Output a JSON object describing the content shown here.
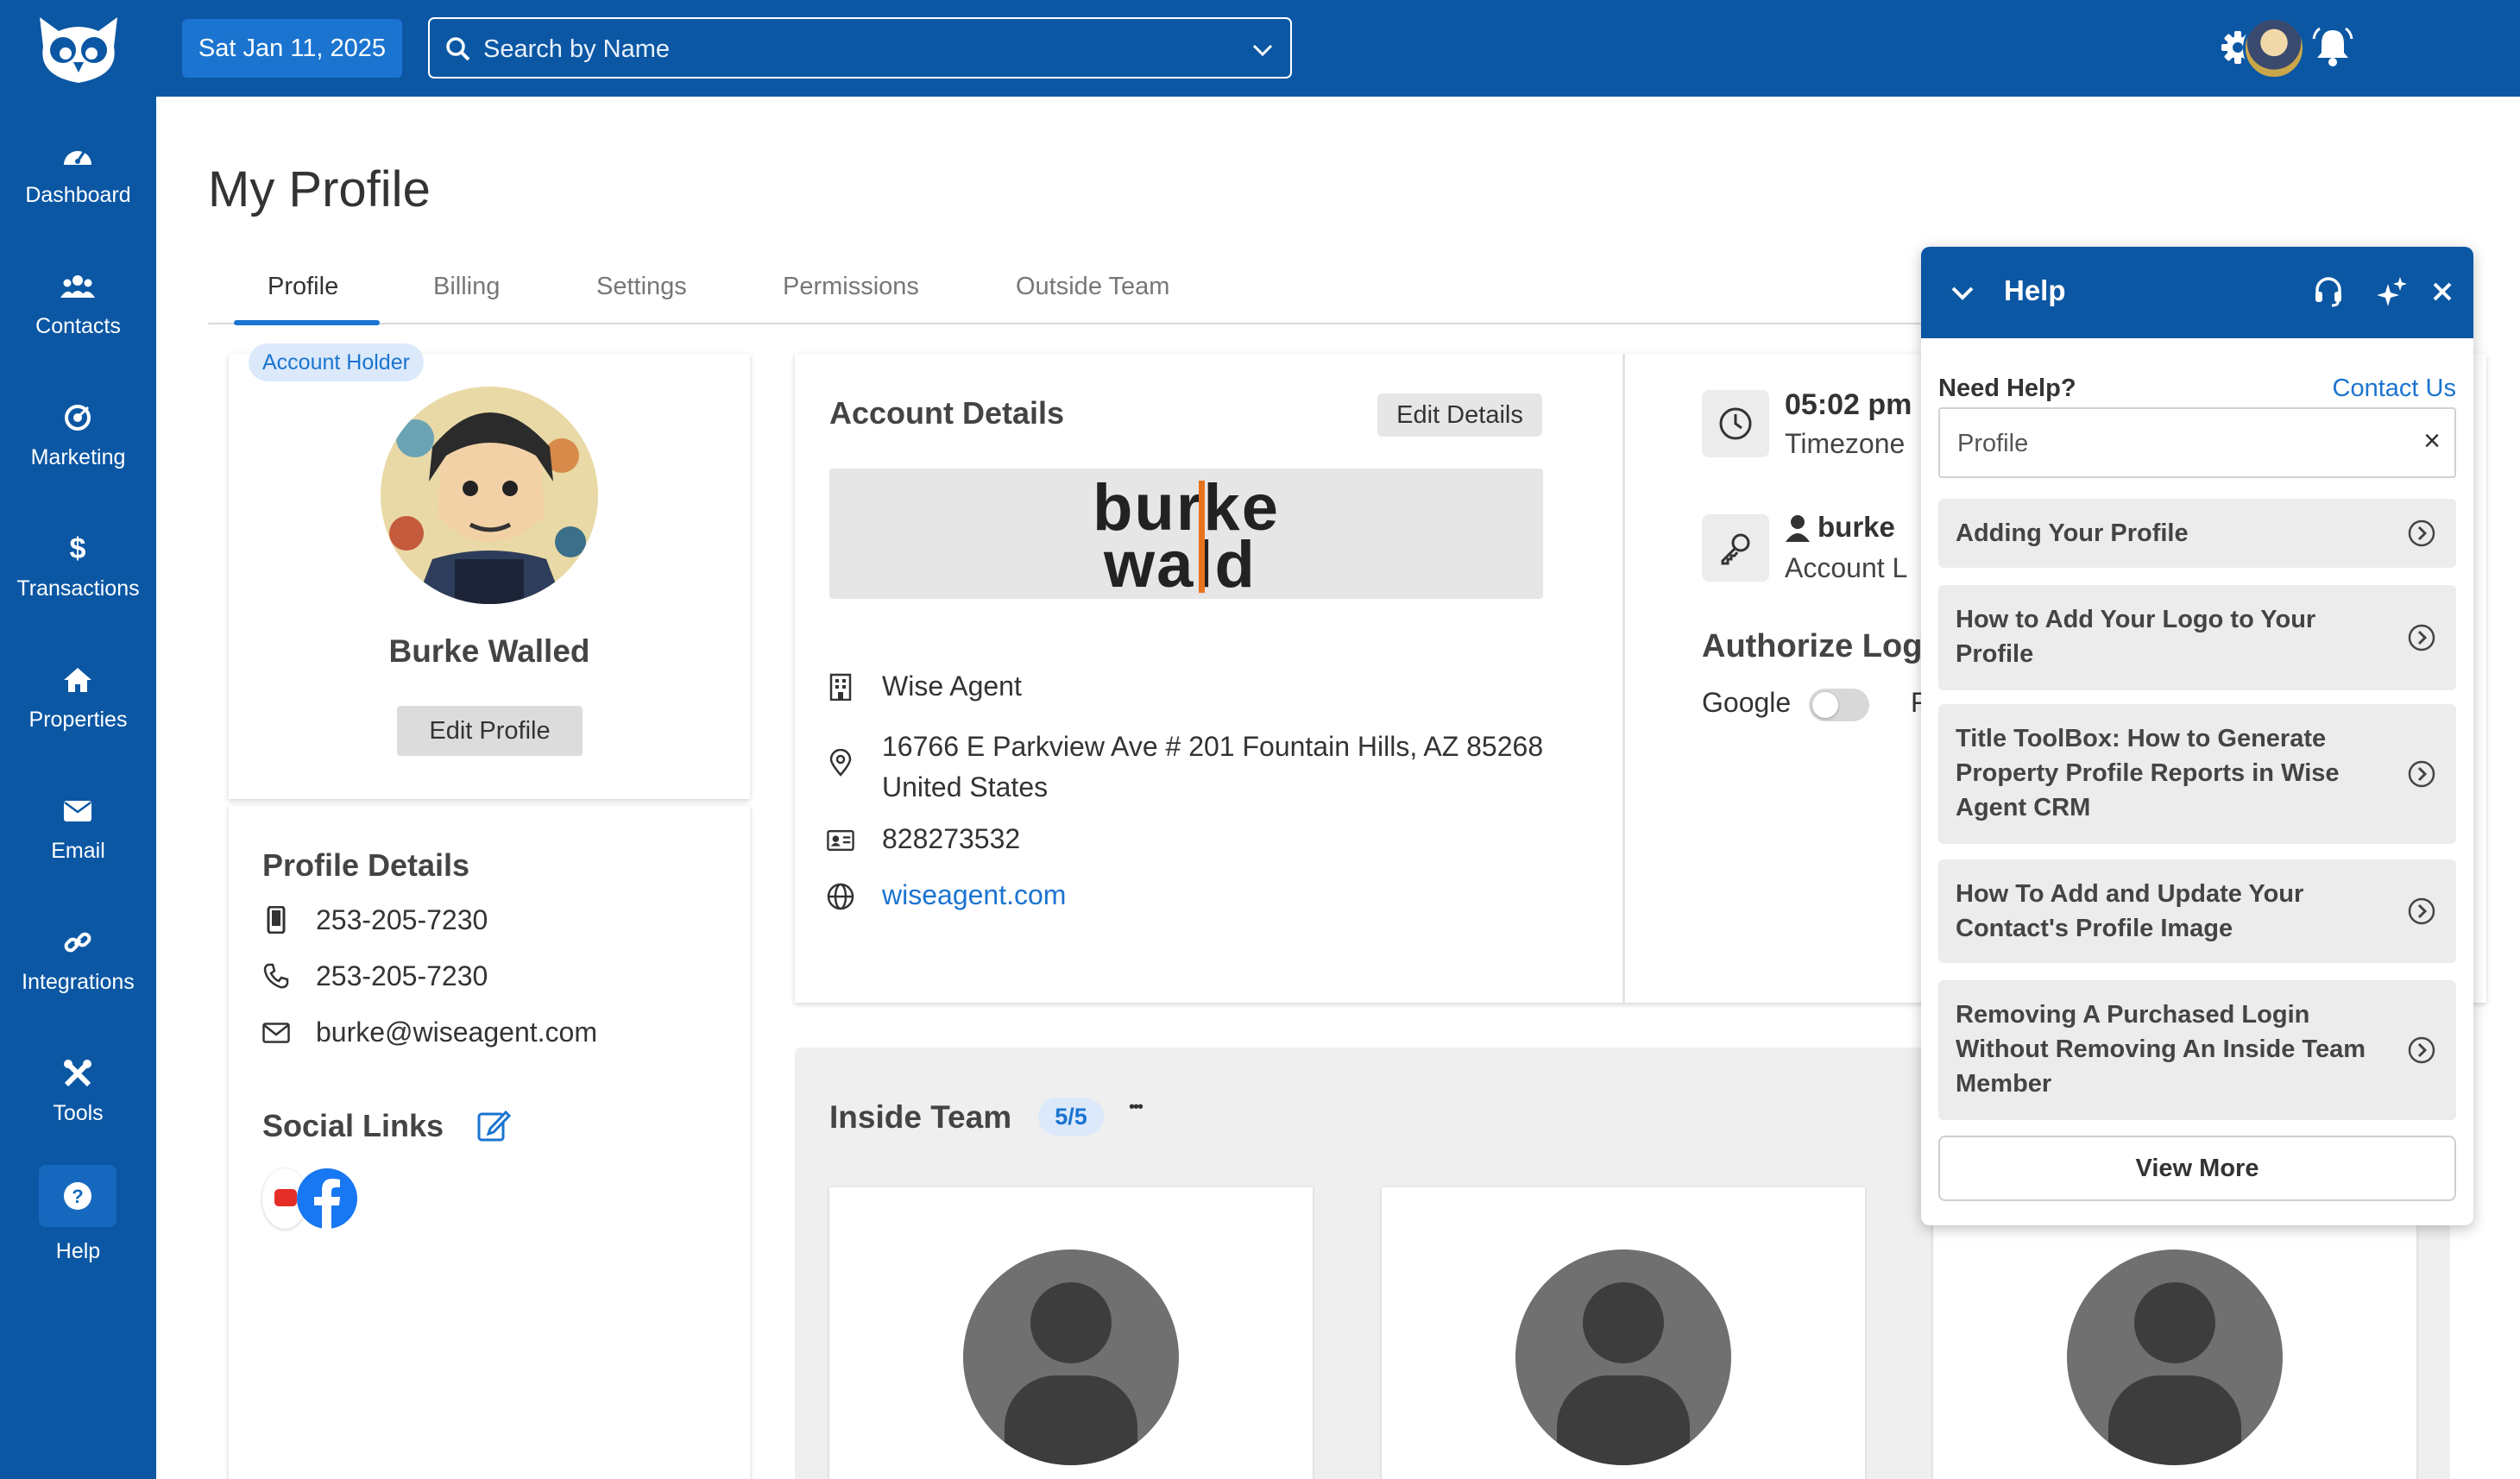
{
  "sidebar": {
    "logo_icon": "owl-logo-icon",
    "items": [
      {
        "label": "Dashboard",
        "icon": "dashboard-icon"
      },
      {
        "label": "Contacts",
        "icon": "contacts-icon"
      },
      {
        "label": "Marketing",
        "icon": "marketing-icon"
      },
      {
        "label": "Transactions",
        "icon": "dollar-icon"
      },
      {
        "label": "Properties",
        "icon": "home-icon"
      },
      {
        "label": "Email",
        "icon": "envelope-icon"
      },
      {
        "label": "Integrations",
        "icon": "link-icon"
      },
      {
        "label": "Tools",
        "icon": "tools-icon"
      },
      {
        "label": "Help",
        "icon": "question-icon"
      }
    ],
    "active": "Help"
  },
  "topbar": {
    "date": "Sat Jan 11, 2025",
    "search_placeholder": "Search by Name"
  },
  "page": {
    "title": "My Profile",
    "tabs": [
      "Profile",
      "Billing",
      "Settings",
      "Permissions",
      "Outside Team"
    ],
    "active_tab": "Profile"
  },
  "profile": {
    "badge": "Account Holder",
    "name": "Burke Walled",
    "edit_button": "Edit Profile",
    "details_heading": "Profile Details",
    "mobile": "253-205-7230",
    "phone": "253-205-7230",
    "email": "burke@wiseagent.com",
    "social_heading": "Social Links"
  },
  "account": {
    "heading": "Account Details",
    "edit_button": "Edit Details",
    "brand_line1": "burke",
    "brand_line2": "wald",
    "company": "Wise Agent",
    "address": "16766 E Parkview Ave # 201 Fountain Hills, AZ 85268 United States",
    "license": "828273532",
    "website": "wiseagent.com",
    "accent_color": "#e8731c"
  },
  "account_side": {
    "time": "05:02 pm",
    "timezone_label": "Timezone",
    "username": "burke",
    "account_label": "Account L",
    "authorize_heading": "Authorize Log",
    "google_label": "Google",
    "extra_letter": "F"
  },
  "team": {
    "heading": "Inside Team",
    "count": "5/5",
    "more": "•••"
  },
  "help": {
    "title": "Help",
    "need_help": "Need Help?",
    "contact_us": "Contact Us",
    "search_value": "Profile",
    "clear": "×",
    "items": [
      "Adding Your Profile",
      "How to Add Your Logo to Your Profile",
      "Title ToolBox: How to Generate Property Profile Reports in Wise Agent CRM",
      "How To Add and Update Your Contact's Profile Image",
      "Removing A Purchased Login Without Removing An Inside Team Member"
    ],
    "view_more": "View More"
  },
  "colors": {
    "brand_blue": "#0b57a4",
    "link_blue": "#1b74d0"
  }
}
